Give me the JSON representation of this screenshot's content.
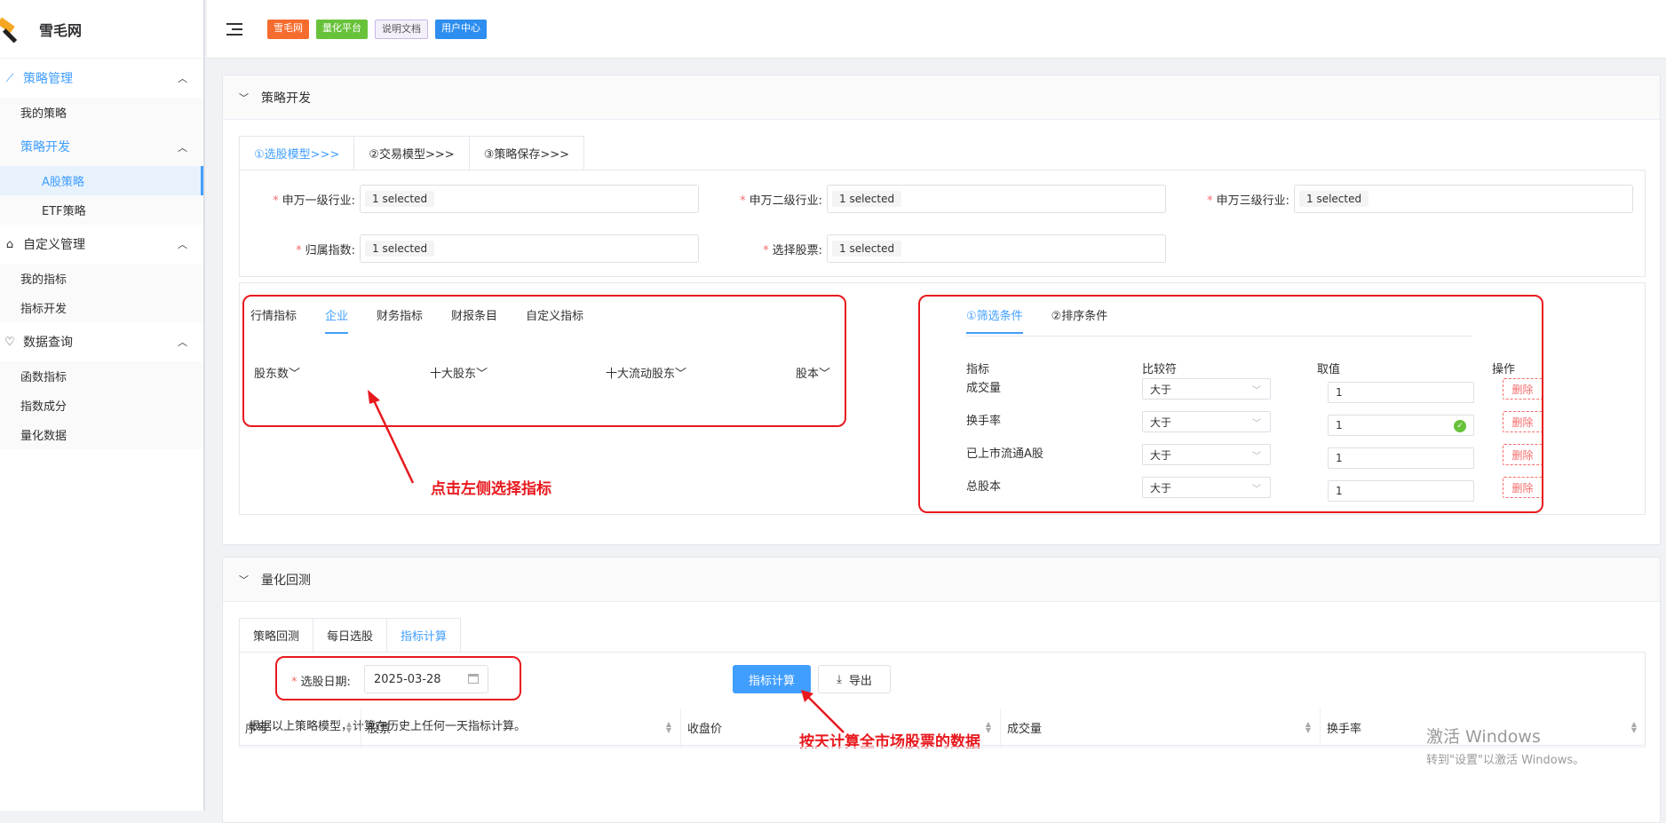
{
  "app": {
    "title": "雪毛网"
  },
  "sidebar": {
    "groups": [
      {
        "label": "策略管理",
        "icon": "chart-line-icon",
        "active": true,
        "items": [
          {
            "label": "我的策略"
          },
          {
            "label": "策略开发",
            "open": true,
            "children": [
              {
                "label": "A股策略",
                "selected": true
              },
              {
                "label": "ETF策略"
              }
            ]
          }
        ]
      },
      {
        "label": "自定义管理",
        "icon": "bank-icon",
        "items": [
          {
            "label": "我的指标"
          },
          {
            "label": "指标开发"
          }
        ]
      },
      {
        "label": "数据查询",
        "icon": "heart-icon",
        "items": [
          {
            "label": "函数指标"
          },
          {
            "label": "指数成分"
          },
          {
            "label": "量化数据"
          }
        ]
      }
    ]
  },
  "topbar": {
    "badges": [
      "雪毛网",
      "量化平台",
      "说明文档",
      "用户中心"
    ],
    "colors": {
      "b1": "#f56c2e",
      "b2": "#67c23a",
      "b3": "#f4f0fa",
      "b4": "#2e8ef0"
    }
  },
  "strategy": {
    "header": "策略开发",
    "tabs": [
      "①选股模型>>>",
      "②交易模型>>>",
      "③策略保存>>>"
    ],
    "fields": [
      {
        "label": "申万一级行业:",
        "value": "1 selected"
      },
      {
        "label": "申万二级行业:",
        "value": "1 selected"
      },
      {
        "label": "申万三级行业:",
        "value": "1 selected"
      },
      {
        "label": "归属指数:",
        "value": "1 selected"
      },
      {
        "label": "选择股票:",
        "value": "1 selected"
      }
    ],
    "indicator_tabs": [
      "行情指标",
      "企业",
      "财务指标",
      "财报条目",
      "自定义指标"
    ],
    "indicator_dropdowns": [
      "股东数",
      "十大股东",
      "十大流动股东",
      "股本"
    ],
    "condition_tabs": [
      "①筛选条件",
      "②排序条件"
    ],
    "condition_headers": [
      "指标",
      "比较符",
      "取值",
      "操作"
    ],
    "conditions": [
      {
        "name": "成交量",
        "op": "大于",
        "value": "1",
        "action": "删除"
      },
      {
        "name": "换手率",
        "op": "大于",
        "value": "1",
        "action": "删除"
      },
      {
        "name": "已上市流通A股",
        "op": "大于",
        "value": "1",
        "action": "删除"
      },
      {
        "name": "总股本",
        "op": "大于",
        "value": "1",
        "action": "删除"
      }
    ],
    "annotation": "点击左侧选择指标"
  },
  "backtest": {
    "header": "量化回测",
    "tabs": [
      "策略回测",
      "每日选股",
      "指标计算"
    ],
    "date_label": "选股日期:",
    "date_value": "2025-03-28",
    "calc_button": "指标计算",
    "export_button": "导出",
    "hint": "根据以上策略模型，计算在历史上任何一天指标计算。",
    "annotation": "按天计算全市场股票的数据",
    "columns": [
      "序号",
      "股票",
      "收盘价",
      "成交量",
      "换手率"
    ]
  },
  "watermark": {
    "line1": "激活 Windows",
    "line2": "转到\"设置\"以激活 Windows。"
  },
  "colors": {
    "accent": "#409eff",
    "annotation": "#e8191e",
    "success": "#67c23a",
    "danger": "#f56c6c"
  }
}
